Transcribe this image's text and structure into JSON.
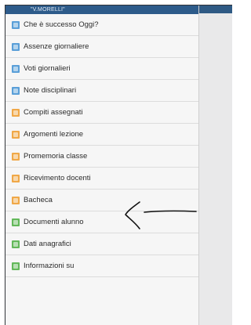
{
  "header": {
    "title": "\"V.MORELLI\""
  },
  "colors": {
    "header": "#2d5b8a",
    "blue": "#5a9fd8",
    "orange": "#f0a848",
    "green": "#63b85a"
  },
  "menu": {
    "items": [
      {
        "label": "Che è successo Oggi?",
        "icon": "info-icon",
        "color": "blue"
      },
      {
        "label": "Assenze giornaliere",
        "icon": "absence-icon",
        "color": "blue"
      },
      {
        "label": "Voti giornalieri",
        "icon": "grades-icon",
        "color": "blue"
      },
      {
        "label": "Note disciplinari",
        "icon": "notes-icon",
        "color": "blue"
      },
      {
        "label": "Compiti assegnati",
        "icon": "homework-icon",
        "color": "orange"
      },
      {
        "label": "Argomenti lezione",
        "icon": "topics-icon",
        "color": "orange"
      },
      {
        "label": "Promemoria classe",
        "icon": "reminder-icon",
        "color": "orange"
      },
      {
        "label": "Ricevimento docenti",
        "icon": "meeting-icon",
        "color": "orange"
      },
      {
        "label": "Bacheca",
        "icon": "board-icon",
        "color": "orange"
      },
      {
        "label": "Documenti alunno",
        "icon": "documents-icon",
        "color": "green"
      },
      {
        "label": "Dati anagrafici",
        "icon": "profile-icon",
        "color": "green"
      },
      {
        "label": "Informazioni su",
        "icon": "about-icon",
        "color": "green"
      }
    ]
  }
}
